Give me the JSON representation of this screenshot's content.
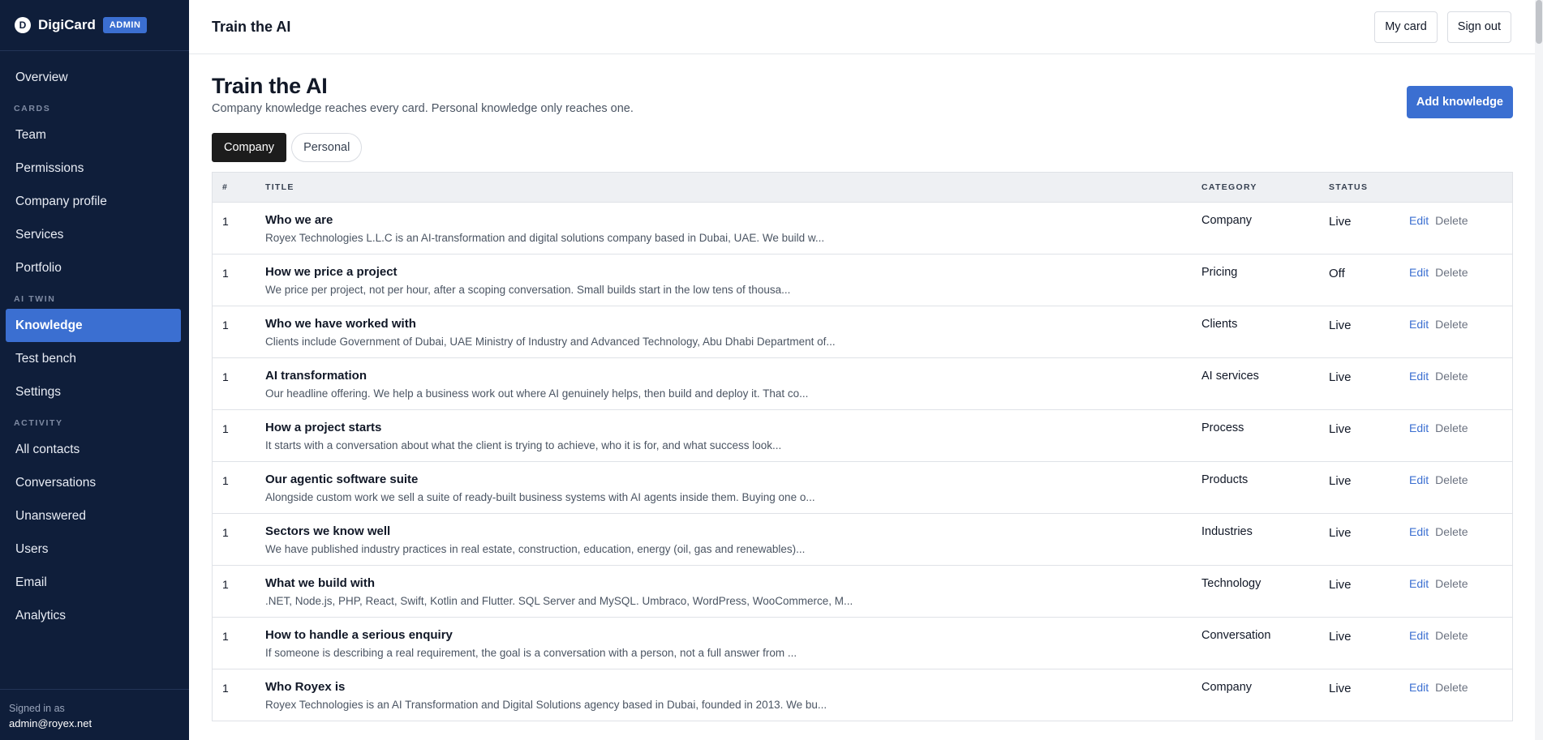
{
  "brand": {
    "logo_letter": "D",
    "name": "DigiCard",
    "badge": "ADMIN"
  },
  "sidebar": {
    "overview": "Overview",
    "section_cards": "CARDS",
    "cards_items": [
      "Team",
      "Permissions",
      "Company profile",
      "Services",
      "Portfolio"
    ],
    "section_ai_twin": "AI TWIN",
    "ai_items": [
      "Knowledge",
      "Test bench",
      "Settings"
    ],
    "section_activity": "ACTIVITY",
    "activity_items": [
      "All contacts",
      "Conversations",
      "Unanswered",
      "Users",
      "Email",
      "Analytics"
    ],
    "active_item": "Knowledge",
    "signed_in_label": "Signed in as",
    "signed_in_email": "admin@royex.net"
  },
  "topbar": {
    "title": "Train the AI",
    "my_card": "My card",
    "sign_out": "Sign out"
  },
  "page": {
    "title": "Train the AI",
    "subtitle": "Company knowledge reaches every card. Personal knowledge only reaches one.",
    "add_button": "Add knowledge"
  },
  "tabs": [
    {
      "label": "Company",
      "active": true
    },
    {
      "label": "Personal",
      "active": false
    }
  ],
  "table": {
    "headers": {
      "num": "#",
      "title": "TITLE",
      "category": "CATEGORY",
      "status": "STATUS"
    },
    "edit_label": "Edit",
    "delete_label": "Delete",
    "rows": [
      {
        "num": "1",
        "title": "Who we are",
        "desc": "Royex Technologies L.L.C is an AI-transformation and digital solutions company based in Dubai, UAE. We build w...",
        "category": "Company",
        "status": "Live"
      },
      {
        "num": "1",
        "title": "How we price a project",
        "desc": "We price per project, not per hour, after a scoping conversation. Small builds start in the low tens of thousa...",
        "category": "Pricing",
        "status": "Off"
      },
      {
        "num": "1",
        "title": "Who we have worked with",
        "desc": "Clients include Government of Dubai, UAE Ministry of Industry and Advanced Technology, Abu Dhabi Department of...",
        "category": "Clients",
        "status": "Live"
      },
      {
        "num": "1",
        "title": "AI transformation",
        "desc": "Our headline offering. We help a business work out where AI genuinely helps, then build and deploy it. That co...",
        "category": "AI services",
        "status": "Live"
      },
      {
        "num": "1",
        "title": "How a project starts",
        "desc": "It starts with a conversation about what the client is trying to achieve, who it is for, and what success look...",
        "category": "Process",
        "status": "Live"
      },
      {
        "num": "1",
        "title": "Our agentic software suite",
        "desc": "Alongside custom work we sell a suite of ready-built business systems with AI agents inside them. Buying one o...",
        "category": "Products",
        "status": "Live"
      },
      {
        "num": "1",
        "title": "Sectors we know well",
        "desc": "We have published industry practices in real estate, construction, education, energy (oil, gas and renewables)...",
        "category": "Industries",
        "status": "Live"
      },
      {
        "num": "1",
        "title": "What we build with",
        "desc": ".NET, Node.js, PHP, React, Swift, Kotlin and Flutter. SQL Server and MySQL. Umbraco, WordPress, WooCommerce, M...",
        "category": "Technology",
        "status": "Live"
      },
      {
        "num": "1",
        "title": "How to handle a serious enquiry",
        "desc": "If someone is describing a real requirement, the goal is a conversation with a person, not a full answer from ...",
        "category": "Conversation",
        "status": "Live"
      },
      {
        "num": "1",
        "title": "Who Royex is",
        "desc": "Royex Technologies is an AI Transformation and Digital Solutions agency based in Dubai, founded in 2013. We bu...",
        "category": "Company",
        "status": "Live"
      }
    ]
  }
}
